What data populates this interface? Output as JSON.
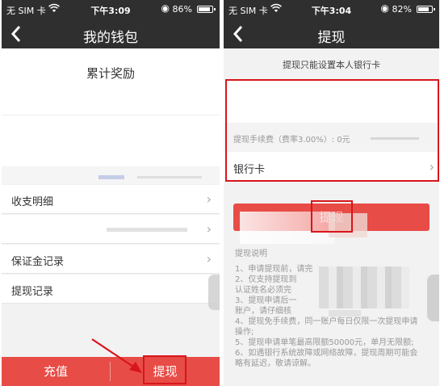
{
  "left_screen": {
    "status": {
      "carrier": "无 SIM 卡",
      "wifi_icon": "wifi-icon",
      "time": "下午3:09",
      "lock_icon": "rotation-lock-icon",
      "battery": "86%",
      "battery_level": 0.86
    },
    "nav": {
      "back_icon": "chevron-left-icon",
      "title": "我的钱包"
    },
    "reward_title": "累计奖励",
    "menu": {
      "items": [
        {
          "label": "收支明细",
          "chevron": "chevron-right-icon"
        },
        {
          "label": "",
          "chevron": "chevron-right-icon"
        },
        {
          "label": "保证金记录",
          "chevron": "chevron-right-icon"
        },
        {
          "label": "提现记录",
          "chevron": ""
        }
      ]
    },
    "bottom": {
      "recharge": "充值",
      "withdraw": "提现"
    },
    "annotation": {
      "arrow_color": "#d8151b",
      "highlight_color": "#d8151b"
    }
  },
  "right_screen": {
    "status": {
      "carrier": "无 SIM 卡",
      "wifi_icon": "wifi-icon",
      "time": "下午3:04",
      "lock_icon": "rotation-lock-icon",
      "battery": "82%",
      "battery_level": 0.82
    },
    "nav": {
      "back_icon": "chevron-left-icon",
      "title": "提现"
    },
    "notice": "提现只能设置本人银行卡",
    "fee_text": "提现手续费（费率3.00%）: 0元",
    "bank_card_label": "银行卡",
    "submit_label": "提现",
    "instructions": {
      "heading": "提现说明",
      "lines": [
        "1、申请提现前，请完",
        "2、仅支持提现到",
        "认证姓名必须完",
        "3、提现申请后一",
        "账户，请仔细核",
        "4、提现免手续费，同一账户每日仅限一次提现申请",
        "操作;",
        "5、提现申请单笔最高限额50000元，单月无限额;",
        "6、如遇银行系统故障或网络故障，提现周期可能会",
        "略有延迟，敬请谅解。"
      ]
    }
  },
  "colors": {
    "nav_bg": "#2f2f2f",
    "accent_red": "#e84c46",
    "annotation_red": "#d8151b",
    "page_bg": "#f2f2f2"
  }
}
